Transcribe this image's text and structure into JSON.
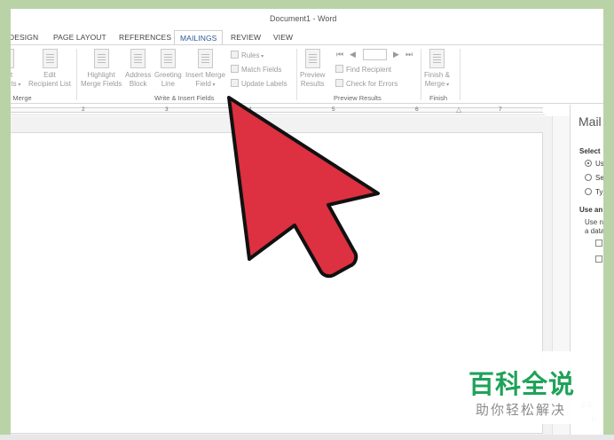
{
  "window": {
    "title": "Document1 - Word"
  },
  "tabs": [
    {
      "label": "DESIGN"
    },
    {
      "label": "PAGE LAYOUT"
    },
    {
      "label": "REFERENCES"
    },
    {
      "label": "MAILINGS",
      "active": true
    },
    {
      "label": "REVIEW"
    },
    {
      "label": "VIEW"
    }
  ],
  "ribbon": {
    "start_group": {
      "line1": "ct",
      "line2": "nts",
      "group_label": "il Merge"
    },
    "edit_recipient": {
      "line1": "Edit",
      "line2": "Recipient List"
    },
    "highlight": {
      "line1": "Highlight",
      "line2": "Merge Fields"
    },
    "address_block": {
      "line1": "Address",
      "line2": "Block"
    },
    "greeting_line": {
      "line1": "Greeting",
      "line2": "Line"
    },
    "insert_merge": {
      "line1": "Insert Merge",
      "line2": "Field"
    },
    "rules": "Rules",
    "match_fields": "Match Fields",
    "update_labels": "Update Labels",
    "write_insert_label": "Write & Insert Fields",
    "preview": {
      "line1": "Preview",
      "line2": "Results"
    },
    "find_recipient": "Find Recipient",
    "check_errors": "Check for Errors",
    "preview_results_label": "Preview Results",
    "finish": {
      "line1": "Finish &",
      "line2": "Merge"
    },
    "finish_label": "Finish"
  },
  "ruler": {
    "numbers": [
      "2",
      "3",
      "4",
      "5",
      "6",
      "7"
    ]
  },
  "pane": {
    "title": "Mail",
    "select_label": "Select",
    "option1": "Us",
    "option2": "Se",
    "option3": "Ty",
    "use_label": "Use an",
    "use_text1": "Use n",
    "use_text2": "a data",
    "step_text": "p 3",
    "nav_text": "P"
  },
  "watermark": {
    "title": "百科全说",
    "subtitle": "助你轻松解决"
  },
  "colors": {
    "arrow_fill": "#dd3040",
    "accent": "#2b579a",
    "watermark_green": "#1fa25a",
    "background_green": "#b9d3a7"
  }
}
